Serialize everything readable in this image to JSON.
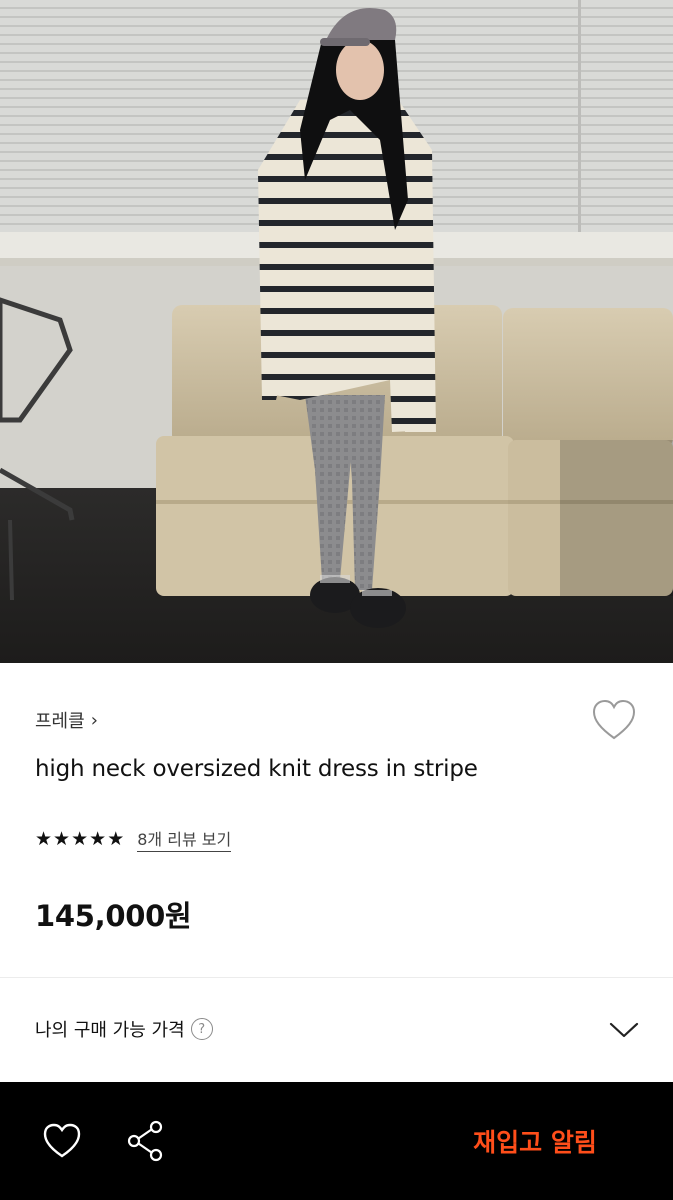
{
  "product": {
    "image_alt": "",
    "brand": "프레클",
    "brand_chevron": "›",
    "title": "high neck oversized knit dress in stripe",
    "rating_stars": 5,
    "review_link": "8개 리뷰 보기",
    "price": "145,000원"
  },
  "purchase_price": {
    "label": "나의 구매 가능 가격",
    "help": "?"
  },
  "bottom_bar": {
    "restock_label": "재입고 알림"
  },
  "colors": {
    "accent": "#ff4e1a",
    "bar_bg": "#000000",
    "text": "#111111"
  },
  "icons": {
    "wishlist": "heart-icon",
    "share": "share-icon",
    "expand": "chevron-down-icon",
    "help": "question-circle-icon"
  }
}
